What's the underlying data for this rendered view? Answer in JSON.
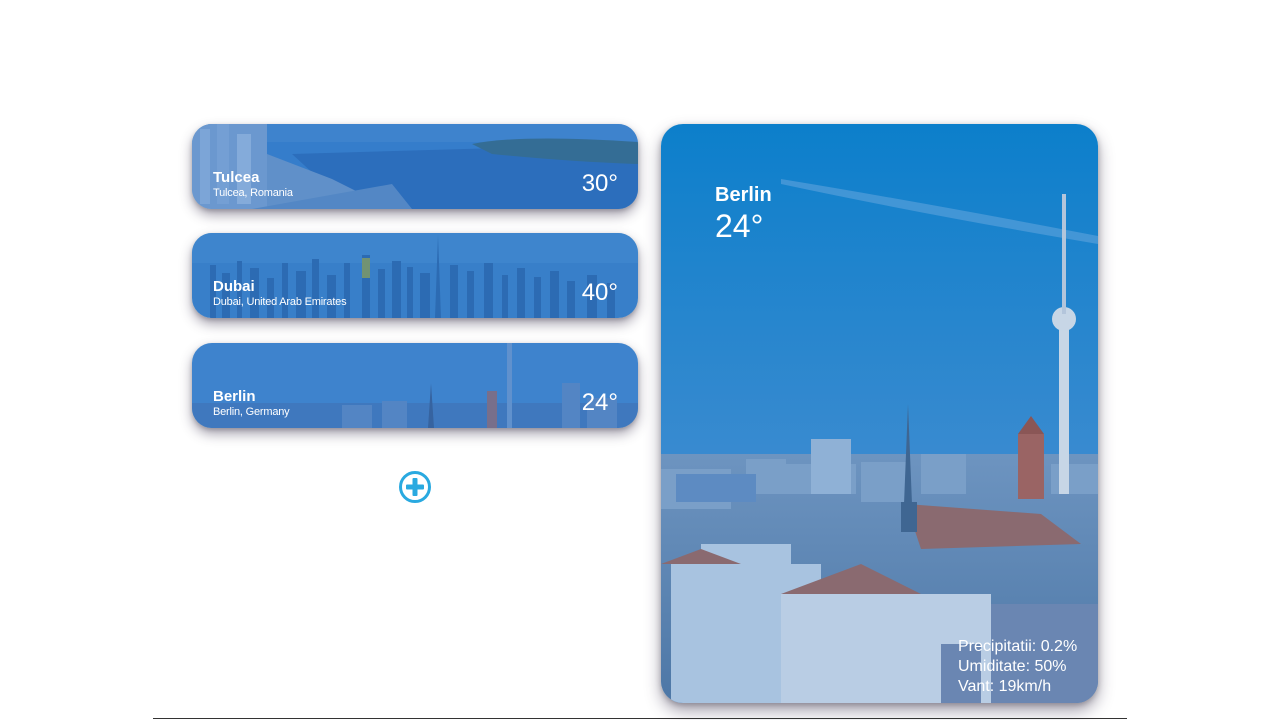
{
  "locations": [
    {
      "city": "Tulcea",
      "region": "Tulcea, Romania",
      "temp": "30°"
    },
    {
      "city": "Dubai",
      "region": "Dubai, United Arab Emirates",
      "temp": "40°"
    },
    {
      "city": "Berlin",
      "region": "Berlin, Germany",
      "temp": "24°"
    }
  ],
  "add_button": {
    "icon": "plus-circle-icon",
    "color": "#29a9e0"
  },
  "detail": {
    "city": "Berlin",
    "temp": "24°",
    "precipitation": "Precipitatii: 0.2%",
    "humidity": "Umiditate: 50%",
    "wind": "Vant: 19km/h"
  },
  "colors": {
    "overlay_blue": "#2a6fc4",
    "accent": "#29a9e0"
  }
}
